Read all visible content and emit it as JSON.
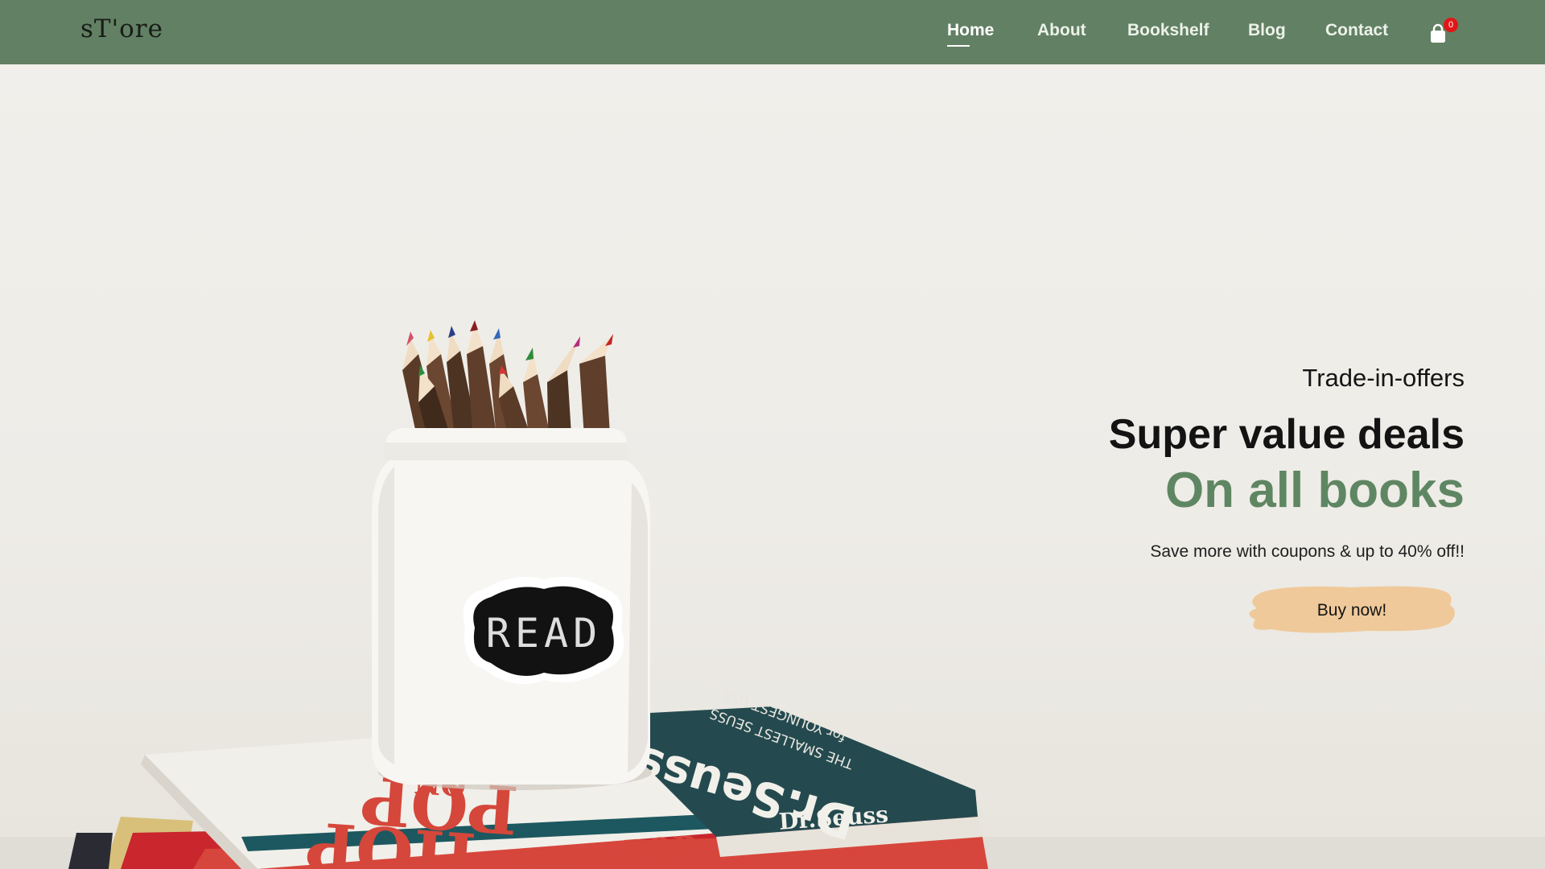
{
  "brand": {
    "logo_text": "sT'ore"
  },
  "nav": {
    "items": [
      {
        "label": "Home",
        "active": true
      },
      {
        "label": "About",
        "active": false
      },
      {
        "label": "Bookshelf",
        "active": false
      },
      {
        "label": "Blog",
        "active": false
      },
      {
        "label": "Contact",
        "active": false
      }
    ],
    "cart_icon": "shopping-bag-icon",
    "cart_count": "0"
  },
  "hero": {
    "eyebrow": "Trade-in-offers",
    "headline": "Super value deals",
    "headline_accent": "On all books",
    "subtext": "Save more with coupons & up to 40% off!!",
    "cta_label": "Buy now!",
    "photo_label_text": "READ",
    "book_titles": [
      "HOP ON POP",
      "Dr.Seuss",
      "THE SMALLEST SEUSS FOR YOUNGEST USE"
    ]
  },
  "colors": {
    "navbar": "#628063",
    "accent_green": "#5f8662",
    "cta_brush": "#efc99a",
    "badge": "#e11616"
  }
}
